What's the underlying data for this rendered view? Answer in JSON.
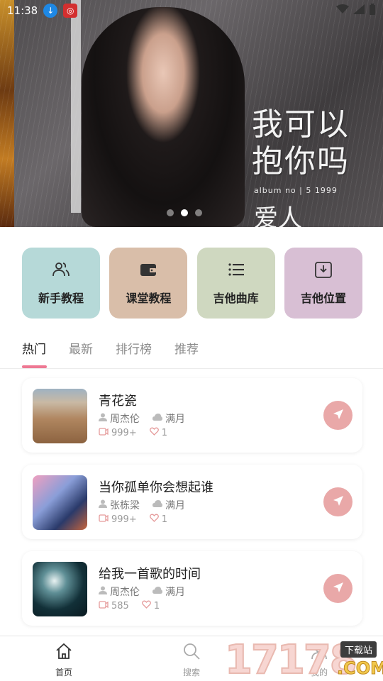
{
  "status_bar": {
    "time": "11:38"
  },
  "banner": {
    "title_line1": "我可以",
    "title_line2": "抱你吗",
    "album_text": "album no | 5 1999",
    "subtitle": "爱人",
    "dots": 3,
    "active_dot": 1
  },
  "categories": [
    {
      "label": "新手教程",
      "icon": "users-icon",
      "color": "#b6d9d8"
    },
    {
      "label": "课堂教程",
      "icon": "wallet-icon",
      "color": "#d9bea9"
    },
    {
      "label": "吉他曲库",
      "icon": "list-icon",
      "color": "#cfd8c0"
    },
    {
      "label": "吉他位置",
      "icon": "download-icon",
      "color": "#d8bfd4"
    }
  ],
  "tabs": [
    "热门",
    "最新",
    "排行榜",
    "推荐"
  ],
  "active_tab": 0,
  "songs": [
    {
      "title": "青花瓷",
      "artist": "周杰伦",
      "quality": "满月",
      "views": "999+",
      "likes": "1"
    },
    {
      "title": "当你孤单你会想起谁",
      "artist": "张栋梁",
      "quality": "满月",
      "views": "999+",
      "likes": "1"
    },
    {
      "title": "给我一首歌的时间",
      "artist": "周杰伦",
      "quality": "满月",
      "views": "585",
      "likes": "1"
    }
  ],
  "bottom_nav": [
    {
      "label": "首页",
      "icon": "home-icon"
    },
    {
      "label": "搜索",
      "icon": "search-icon"
    },
    {
      "label": "我的",
      "icon": "user-icon"
    }
  ],
  "watermark": {
    "number": "17178",
    "tag": "下载站",
    "suffix": ".COM"
  },
  "colors": {
    "accent": "#ee7893",
    "send_button": "#e9a8a8"
  }
}
